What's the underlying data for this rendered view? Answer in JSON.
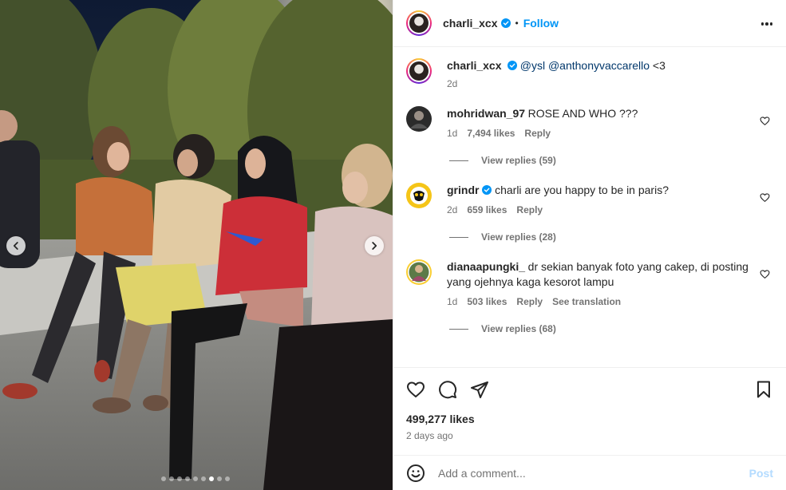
{
  "post": {
    "username": "charli_xcx",
    "follow_label": "Follow",
    "separator": "•",
    "caption_mentions": "@ysl @anthonyvaccarello",
    "caption_tail": " <3",
    "caption_time": "2d",
    "likes": "499,277 likes",
    "posted_ago": "2 days ago",
    "carousel": {
      "slide_count": 9,
      "active_index": 6
    }
  },
  "comments": [
    {
      "username": "mohridwan_97",
      "verified": false,
      "text": "ROSE AND WHO ???",
      "time": "1d",
      "likes": "7,494 likes",
      "reply": "Reply",
      "view_replies": "View replies (59)"
    },
    {
      "username": "grindr",
      "verified": true,
      "text": "charli are you happy to be in paris?",
      "time": "2d",
      "likes": "659 likes",
      "reply": "Reply",
      "view_replies": "View replies (28)"
    },
    {
      "username": "dianaapungki_",
      "verified": false,
      "text": "dr sekian banyak foto yang cakep, di posting yang ojehnya kaga kesorot lampu",
      "time": "1d",
      "likes": "503 likes",
      "reply": "Reply",
      "translation": "See translation",
      "view_replies": "View replies (68)"
    }
  ],
  "composer": {
    "placeholder": "Add a comment...",
    "post_label": "Post"
  },
  "icons": [
    "chevron-left-icon",
    "chevron-right-icon",
    "verified-icon",
    "more-icon",
    "heart-icon",
    "comment-icon",
    "share-icon",
    "bookmark-icon",
    "emoji-icon"
  ],
  "colors": {
    "accent": "#0095f6",
    "verified": "#0095f6",
    "post_disabled": "#b3dbff",
    "muted": "#737373"
  }
}
